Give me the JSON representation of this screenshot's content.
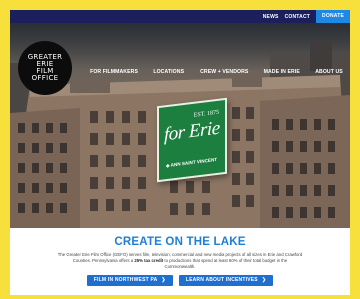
{
  "utility_nav": {
    "news": "NEWS",
    "contact": "CONTACT",
    "donate": "DONATE"
  },
  "logo": {
    "line1": "GREATER",
    "line2": "ERIE",
    "line3": "FILM",
    "line4": "OFFICE"
  },
  "main_nav": {
    "item1": "FOR FILMMAKERS",
    "item2": "LOCATIONS",
    "item3": "CREW + VENDORS",
    "item4": "MADE IN ERIE",
    "item5": "ABOUT US"
  },
  "hero_sign": {
    "est": "EST. 1875",
    "main": "for Erie",
    "sub": "◆ ANN SAINT VINCENT"
  },
  "content": {
    "headline": "CREATE ON THE LAKE",
    "desc_part1": "The Greater Erie Film Office (GEFO) serves film, television, commercial and new media projects of all sizes in Erie and Crawford Counties. Pennsylvania offers a ",
    "desc_bold": "25% tax credit",
    "desc_part2": " to productions that spend at least 60% of their total budget in the Commonwealth.",
    "button1": "FILM IN NORTHWEST PA",
    "button2": "LEARN ABOUT INCENTIVES",
    "arrow": "❯"
  },
  "colors": {
    "background_border": "#f7e03c",
    "utility_bar": "#1b1f5c",
    "donate": "#1e88e5",
    "headline": "#1e7fd6",
    "button": "#1e6fd0",
    "sign_green": "#1d7f3f"
  }
}
